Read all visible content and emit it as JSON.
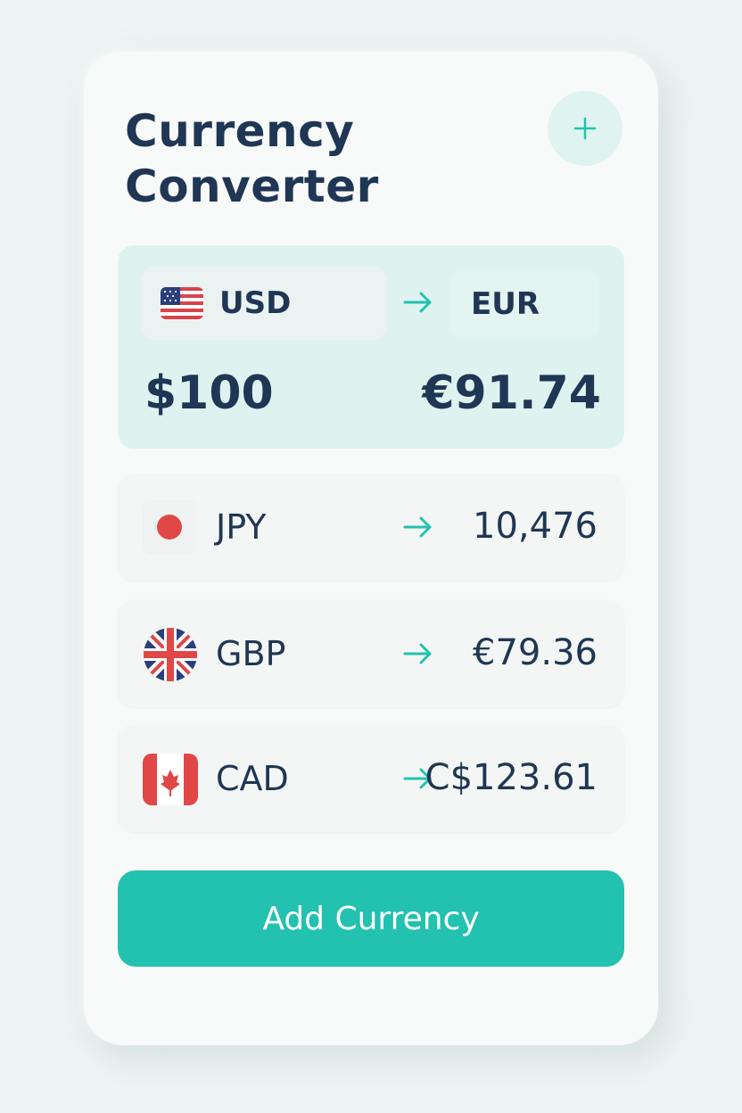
{
  "header": {
    "title": "Currency Converter",
    "add_icon": "plus-icon"
  },
  "featured": {
    "from_code": "USD",
    "from_flag": "us-flag-icon",
    "to_code": "EUR",
    "from_amount": "$100",
    "to_amount": "€91.74"
  },
  "conversions": [
    {
      "code": "JPY",
      "flag": "jp-flag-icon",
      "amount": "10,476"
    },
    {
      "code": "GBP",
      "flag": "uk-flag-icon",
      "amount": "€79.36"
    },
    {
      "code": "CAD",
      "flag": "ca-flag-icon",
      "amount": "C$123.61"
    }
  ],
  "actions": {
    "add_currency_label": "Add Currency"
  },
  "colors": {
    "accent": "#22c1b0",
    "text": "#1f3654",
    "featured_bg": "#def3f0"
  }
}
